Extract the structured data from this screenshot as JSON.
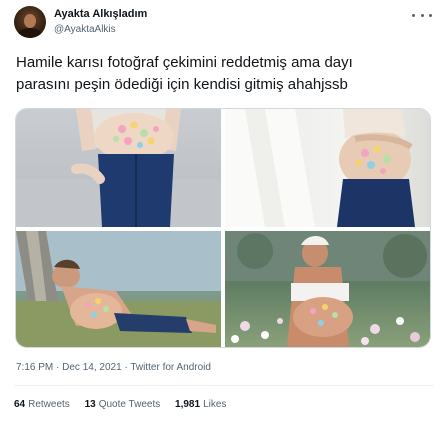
{
  "author": {
    "name": "Ayakta Alkışladım",
    "handle": "@AyaktaAlkis"
  },
  "tweet": {
    "lines": [
      "Hamile karısı fotoğraf çekimini reddetmiş ama dayı",
      "parasını peşin ödediği için kendisi gitmiş ahahjssb"
    ]
  },
  "media": {
    "photos": [
      "maternity-photo-belly-flowers",
      "maternity-photo-belly-white-dress",
      "man-lying-maternity-pose",
      "man-maternity-pose-garden"
    ]
  },
  "meta": {
    "time": "7:16 PM",
    "separator1": " · ",
    "date": "Dec 14, 2021",
    "separator2": " · ",
    "source": "Twitter for Android"
  },
  "stats": {
    "retweets_count": "64",
    "retweets_label": "Retweets",
    "quotes_count": "13",
    "quotes_label": "Quote Tweets",
    "likes_count": "1,981",
    "likes_label": "Likes"
  },
  "colors": {
    "text": "#0f1419",
    "secondary": "#536471",
    "border": "#cfd9de"
  }
}
